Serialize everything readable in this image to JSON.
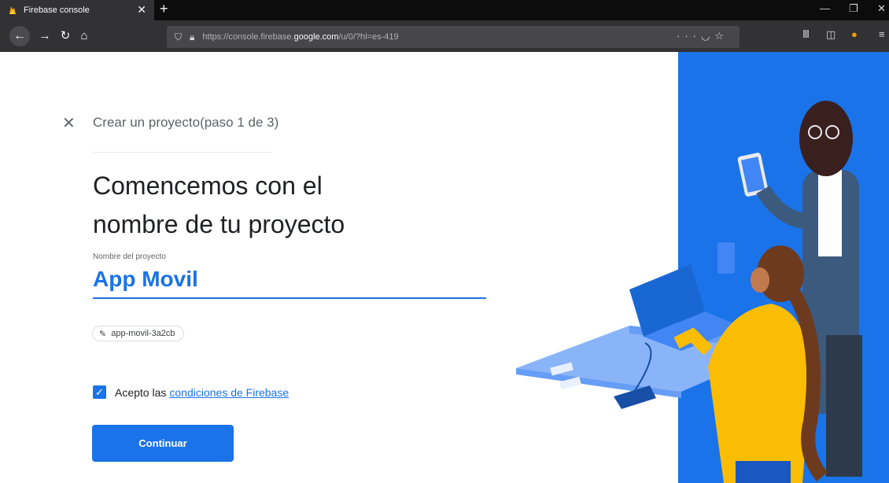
{
  "browser": {
    "tab_title": "Firebase console",
    "tab_close": "✕",
    "new_tab": "+",
    "url_prefix": "https://console.firebase.",
    "url_domain": "google.com",
    "url_suffix": "/u/0/?hl=es-419"
  },
  "wizard": {
    "close_label": "✕",
    "step_label": "Crear un proyecto(paso 1 de 3)",
    "headline_line1": "Comencemos con el",
    "headline_line2": "nombre de tu proyecto",
    "field_label": "Nombre del proyecto",
    "project_name": "App Movil",
    "project_id": "app-movil-3a2cb",
    "terms_prefix": "Acepto las",
    "terms_link": "condiciones de Firebase",
    "terms_checked": true,
    "continue_label": "Continuar"
  },
  "colors": {
    "accent": "#1a73e8",
    "illustration_bg": "#1a73e8",
    "chrome_dark": "#0c0c0d",
    "toolbar": "#323234"
  },
  "icons": [
    "firefox-icon",
    "back-icon",
    "forward-icon",
    "reload-icon",
    "home-icon",
    "shield-icon",
    "lock-icon",
    "more-icon",
    "pocket-icon",
    "star-icon",
    "library-icon",
    "sidebar-icon",
    "addon-icon",
    "menu-icon",
    "pencil-icon",
    "checkbox-icon"
  ]
}
